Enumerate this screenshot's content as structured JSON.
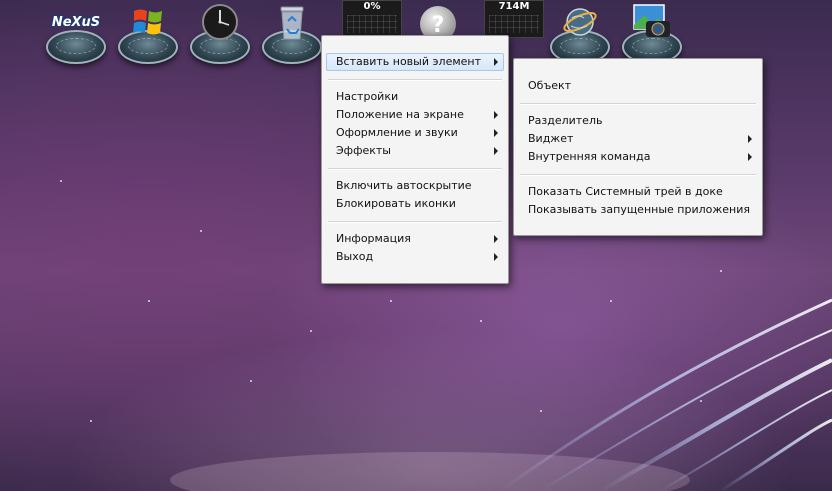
{
  "dock": {
    "items": [
      {
        "name": "nexus-logo-icon",
        "label": "NeXuS"
      },
      {
        "name": "windows-logo-icon",
        "label": ""
      },
      {
        "name": "clock-icon",
        "label": ""
      },
      {
        "name": "recycle-bin-icon",
        "label": ""
      },
      {
        "name": "cpu-meter",
        "label": "0%"
      },
      {
        "name": "help-icon",
        "label": "?"
      },
      {
        "name": "memory-meter",
        "label": "714M"
      },
      {
        "name": "internet-globe-icon",
        "label": ""
      },
      {
        "name": "photo-camera-icon",
        "label": ""
      }
    ]
  },
  "main_menu": {
    "items": [
      {
        "label": "Вставить новый элемент",
        "submenu": true,
        "highlighted": true
      },
      {
        "separator": true
      },
      {
        "label": "Настройки",
        "submenu": false
      },
      {
        "label": "Положение на экране",
        "submenu": true
      },
      {
        "label": "Оформление и звуки",
        "submenu": true
      },
      {
        "label": "Эффекты",
        "submenu": true
      },
      {
        "separator": true
      },
      {
        "label": "Включить автоскрытие",
        "submenu": false
      },
      {
        "label": "Блокировать иконки",
        "submenu": false
      },
      {
        "separator": true
      },
      {
        "label": "Информация",
        "submenu": true
      },
      {
        "label": "Выход",
        "submenu": true
      }
    ]
  },
  "sub_menu": {
    "items": [
      {
        "label": "Объект",
        "submenu": false
      },
      {
        "separator": true
      },
      {
        "label": "Разделитель",
        "submenu": false
      },
      {
        "label": "Виджет",
        "submenu": true
      },
      {
        "label": "Внутренняя команда",
        "submenu": true
      },
      {
        "separator": true
      },
      {
        "label": "Показать Системный трей в доке",
        "submenu": false
      },
      {
        "label": "Показывать запущенные приложения",
        "submenu": false
      }
    ]
  }
}
